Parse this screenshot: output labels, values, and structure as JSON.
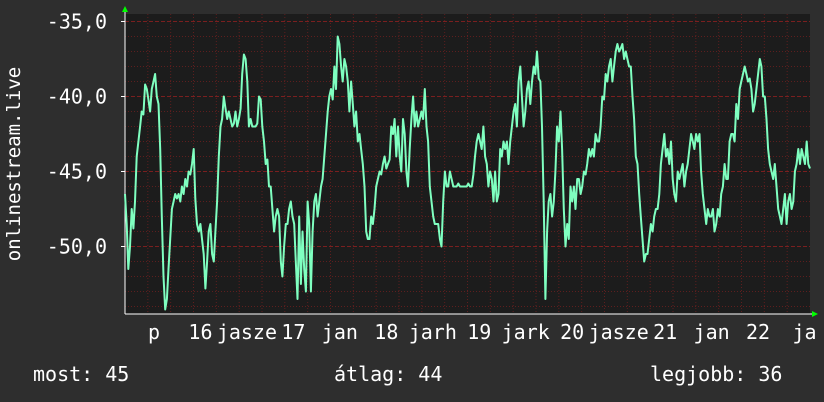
{
  "chart_data": {
    "type": "line",
    "ylabel": "onlinestream.live",
    "ylim": [
      -54.5,
      -34.5
    ],
    "y_ticks": [
      "-35,0",
      "-40,0",
      "-45,0",
      "-50,0"
    ],
    "y_tick_values": [
      -35,
      -40,
      -45,
      -50
    ],
    "x_tick_labels": [
      "p",
      "16",
      "jasze",
      "17",
      "jan",
      "18",
      "jarh",
      "19",
      "jark",
      "20",
      "jasze",
      "21",
      "jan",
      "22",
      "ja"
    ],
    "grid": true,
    "colors": {
      "background": "#2e2e2e",
      "plot": "#1c1c1c",
      "grid": "#7a1f1f",
      "line": "#7fffc0",
      "axis_arrow": "#00ff00"
    },
    "series": [
      {
        "values": [
          -46.5,
          -48.5,
          -51.5,
          -50,
          -47.5,
          -48.8,
          -47,
          -44,
          -43,
          -42,
          -41,
          -41.2,
          -39.2,
          -39.5,
          -40.2,
          -41,
          -39.5,
          -39,
          -38.5,
          -40,
          -40.5,
          -43.5,
          -48,
          -52,
          -54.2,
          -53.5,
          -51.5,
          -49.5,
          -47.5,
          -47,
          -46.5,
          -46.8,
          -46.5,
          -47,
          -46,
          -46.5,
          -45.5,
          -46,
          -45,
          -45.2,
          -44.5,
          -43.5,
          -46.8,
          -48.5,
          -49,
          -48.5,
          -49.5,
          -50.5,
          -52.8,
          -51,
          -49,
          -48.5,
          -50.5,
          -51,
          -49,
          -47,
          -44,
          -42,
          -41.5,
          -40,
          -40.8,
          -41.5,
          -41,
          -41.5,
          -42,
          -41.8,
          -41,
          -42,
          -41.5,
          -40.8,
          -38.5,
          -37.2,
          -37.5,
          -39,
          -42,
          -41.5,
          -42,
          -42,
          -42,
          -41.8,
          -40,
          -40.2,
          -42,
          -43,
          -44.5,
          -44.2,
          -46,
          -46,
          -47.5,
          -49,
          -48,
          -47.5,
          -48,
          -51,
          -52,
          -50,
          -48.5,
          -48.5,
          -47.5,
          -47,
          -48,
          -48.5,
          -51,
          -53.5,
          -48,
          -52.5,
          -49,
          -51.5,
          -53,
          -47,
          -48.5,
          -53,
          -49,
          -47,
          -46.5,
          -48,
          -47,
          -46,
          -45.5,
          -44,
          -42.5,
          -41,
          -40,
          -39.5,
          -40.2,
          -38,
          -39.5,
          -36,
          -36.5,
          -38,
          -39,
          -37.5,
          -38,
          -39,
          -41,
          -39,
          -40.5,
          -42,
          -41,
          -43,
          -42.5,
          -43.5,
          -44.5,
          -46,
          -49,
          -49.5,
          -49.5,
          -48,
          -48.5,
          -47.5,
          -46,
          -45.5,
          -45,
          -45.2,
          -44.5,
          -44,
          -44.8,
          -44.5,
          -44.2,
          -42,
          -42.5,
          -41.5,
          -44,
          -42,
          -44,
          -45,
          -41.5,
          -42.5,
          -45,
          -46,
          -43.5,
          -41.5,
          -40,
          -42,
          -41,
          -42,
          -41.5,
          -41,
          -41.5,
          -39.5,
          -42,
          -43,
          -46,
          -47,
          -48,
          -48.5,
          -48.5,
          -48.5,
          -49.5,
          -50,
          -47,
          -45,
          -46,
          -46,
          -45,
          -45.5,
          -46,
          -46,
          -46,
          -45.8,
          -46,
          -46,
          -46,
          -46,
          -46,
          -45.8,
          -46,
          -46,
          -45.2,
          -44,
          -43,
          -42.5,
          -43,
          -43.5,
          -42,
          -44,
          -44.5,
          -46,
          -45,
          -45.5,
          -47,
          -45,
          -47,
          -46.5,
          -43.5,
          -44,
          -43,
          -43.5,
          -43,
          -44.5,
          -43,
          -42,
          -41,
          -40.5,
          -42,
          -39,
          -38,
          -40,
          -42,
          -41,
          -39.5,
          -39,
          -40.5,
          -39,
          -38,
          -38.5,
          -37,
          -38.8,
          -39,
          -42,
          -47,
          -53.5,
          -49,
          -47,
          -46.5,
          -48,
          -47,
          -45,
          -42,
          -43,
          -41,
          -43.5,
          -47.5,
          -50,
          -48.5,
          -49.5,
          -46,
          -47,
          -46,
          -47.5,
          -45.5,
          -45.5,
          -46.5,
          -46,
          -45,
          -45.2,
          -44.5,
          -43.5,
          -44,
          -43.5,
          -44,
          -42.5,
          -43,
          -43,
          -42,
          -40,
          -40.2,
          -38.5,
          -39,
          -38,
          -37.5,
          -39,
          -38,
          -37,
          -36.5,
          -37,
          -36.8,
          -36.5,
          -37.5,
          -37,
          -37.5,
          -38,
          -38,
          -40,
          -41.5,
          -44,
          -44.5,
          -46.5,
          -48,
          -49.5,
          -51,
          -50.5,
          -50.5,
          -49.5,
          -48.5,
          -49,
          -48,
          -47.5,
          -47.5,
          -46.5,
          -44.5,
          -43.5,
          -42.5,
          -44,
          -43.5,
          -44.5,
          -43,
          -45.5,
          -46.5,
          -47,
          -45,
          -45.5,
          -45,
          -44.5,
          -46,
          -45,
          -44.5,
          -43.5,
          -42.5,
          -43,
          -43.5,
          -42.5,
          -43,
          -42.5,
          -45,
          -46.5,
          -47.5,
          -48.5,
          -47.5,
          -48,
          -48,
          -47.5,
          -49,
          -48.5,
          -47.5,
          -48,
          -46.5,
          -46,
          -44.5,
          -45.5,
          -45.5,
          -43,
          -42.5,
          -42.5,
          -43,
          -40.5,
          -41.5,
          -39.5,
          -39,
          -38.5,
          -38,
          -38.5,
          -39,
          -38.8,
          -39.5,
          -41,
          -40.5,
          -39.5,
          -38.5,
          -37.5,
          -38,
          -40,
          -40,
          -41.5,
          -43.5,
          -44.5,
          -45,
          -45.5,
          -44.5,
          -46,
          -47.5,
          -48,
          -48.5,
          -47.5,
          -46.5,
          -48.5,
          -47,
          -46.5,
          -47.5,
          -47,
          -45,
          -44.5,
          -43.5,
          -44.5,
          -43.5,
          -44,
          -44.5,
          -43,
          -44.5,
          -44.8
        ]
      }
    ]
  },
  "stats": {
    "current": "most: 45",
    "average": "átlag: 44",
    "best": "legjobb: 36"
  }
}
